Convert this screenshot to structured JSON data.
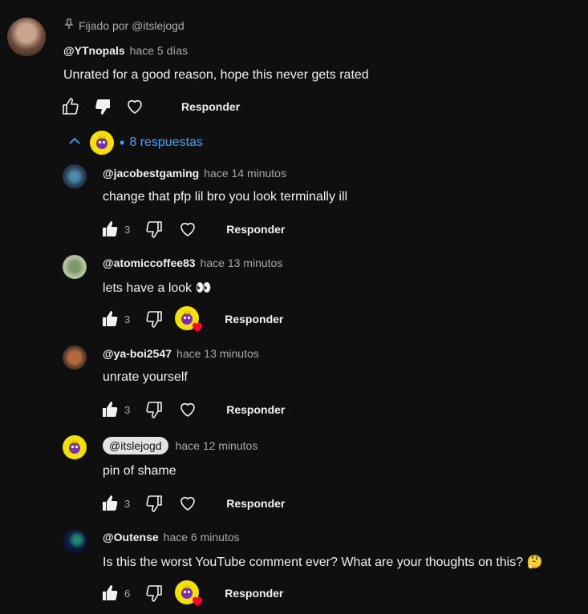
{
  "pinned": {
    "label": "Fijado por @itslejogd",
    "author": "@YTnopals",
    "time": "hace 5 días",
    "text": "Unrated for a good reason, hope this never gets rated",
    "reply_label": "Responder"
  },
  "replies_toggle": {
    "label": "8 respuestas"
  },
  "replies": [
    {
      "author": "@jacobestgaming",
      "time": "hace 14 minutos",
      "text": "change that pfp lil bro you look terminally ill",
      "likes": "3",
      "reply_label": "Responder",
      "creator_heart": false
    },
    {
      "author": "@atomiccoffee83",
      "time": "hace 13 minutos",
      "text": "lets have a look 👀",
      "likes": "3",
      "reply_label": "Responder",
      "creator_heart": true
    },
    {
      "author": "@ya-boi2547",
      "time": "hace 13 minutos",
      "text": "unrate yourself",
      "likes": "3",
      "reply_label": "Responder",
      "creator_heart": false
    },
    {
      "author": "@itslejogd",
      "time": "hace 12 minutos",
      "text": "pin of shame",
      "likes": "3",
      "reply_label": "Responder",
      "creator_heart": false,
      "is_creator": true
    },
    {
      "author": "@Outense",
      "time": "hace 6 minutos",
      "text": "Is this the worst YouTube comment ever? What are your thoughts on this? 🤔",
      "likes": "6",
      "reply_label": "Responder",
      "creator_heart": true
    }
  ],
  "colors": {
    "background": "#0f0f0f",
    "link": "#3ea6ff",
    "heart": "#ff0033",
    "creator_avatar": "#f5e100"
  }
}
